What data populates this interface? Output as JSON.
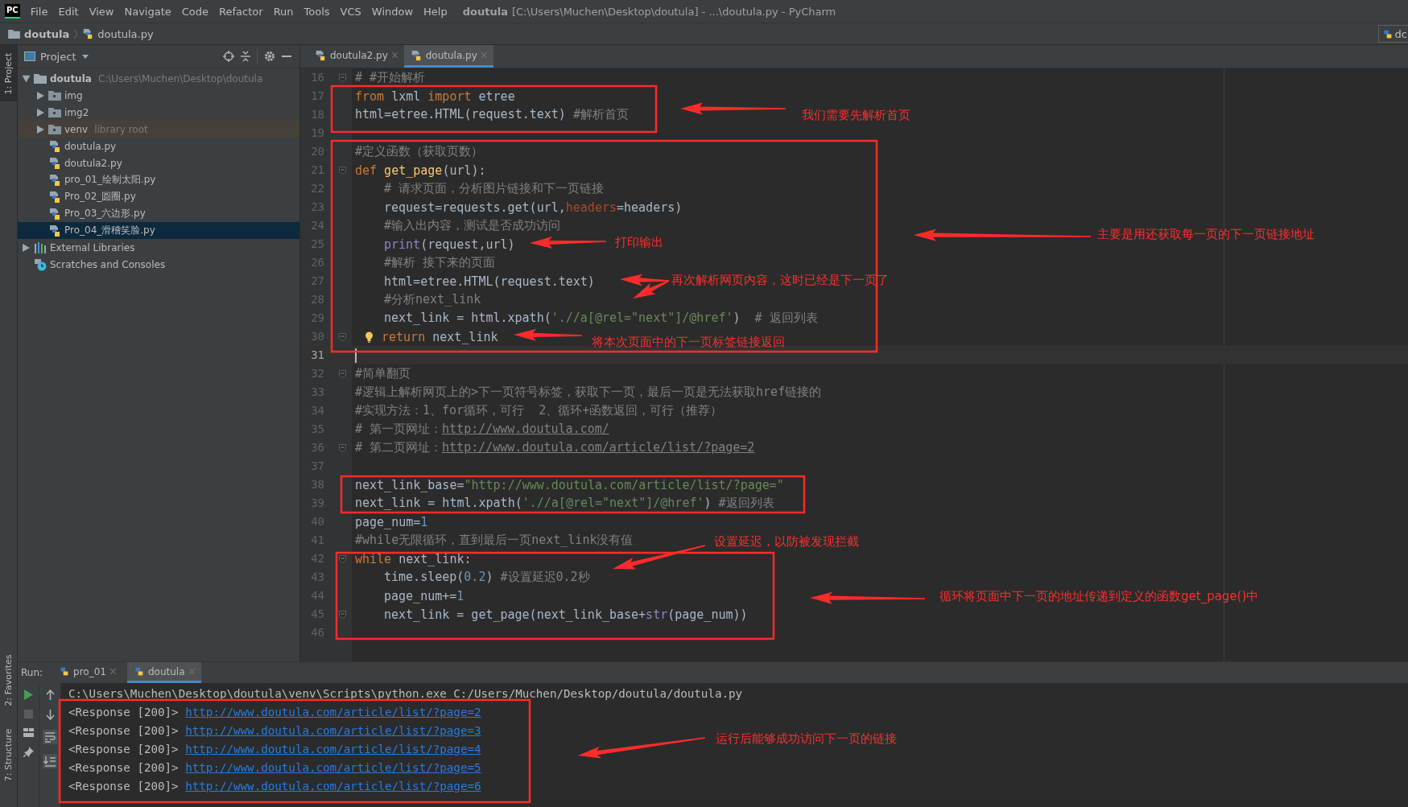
{
  "window": {
    "app_logo": "PC",
    "menu": [
      "File",
      "Edit",
      "View",
      "Navigate",
      "Code",
      "Refactor",
      "Run",
      "Tools",
      "VCS",
      "Window",
      "Help"
    ],
    "title_project": "doutula",
    "title_rest": "[C:\\Users\\Muchen\\Desktop\\doutula] - ...\\doutula.py - PyCharm"
  },
  "breadcrumb": [
    "doutula",
    "doutula.py"
  ],
  "corner_button": "dc",
  "side_tabs": [
    {
      "label": "1: Project",
      "selected": true
    },
    {
      "label": "2: Favorites",
      "selected": false
    },
    {
      "label": "7: Structure",
      "selected": false
    }
  ],
  "project_panel": {
    "title": "Project",
    "tree": [
      {
        "label": "doutula",
        "note": "C:\\Users\\Muchen\\Desktop\\doutula",
        "kind": "root_folder",
        "expanded": true,
        "selected": false,
        "children": [
          {
            "label": "img",
            "kind": "folder",
            "expanded": false,
            "selected": false
          },
          {
            "label": "img2",
            "kind": "folder",
            "expanded": false,
            "selected": false
          },
          {
            "label": "venv",
            "note": "library root",
            "kind": "library_folder",
            "expanded": false,
            "selected": false
          },
          {
            "label": "doutula.py",
            "kind": "python_file",
            "selected": false
          },
          {
            "label": "doutula2.py",
            "kind": "python_file",
            "selected": false
          },
          {
            "label": "pro_01_绘制太阳.py",
            "kind": "python_file",
            "selected": false
          },
          {
            "label": "Pro_02_圆圈.py",
            "kind": "python_file",
            "selected": false
          },
          {
            "label": "Pro_03_六边形.py",
            "kind": "python_file",
            "selected": false
          },
          {
            "label": "Pro_04_滑稽笑脸.py",
            "kind": "python_file",
            "selected": true
          }
        ]
      },
      {
        "label": "External Libraries",
        "kind": "libraries",
        "expanded": false,
        "selected": false
      },
      {
        "label": "Scratches and Consoles",
        "kind": "scratches",
        "selected": false
      }
    ]
  },
  "editor": {
    "tabs": [
      {
        "label": "doutula2.py",
        "selected": false
      },
      {
        "label": "doutula.py",
        "selected": true
      }
    ],
    "lines": [
      {
        "number": "16",
        "indented": false,
        "current": false,
        "fold": true,
        "bulb": false,
        "tokens": [
          {
            "kind": "comment",
            "text": "# #开始解析"
          }
        ]
      },
      {
        "number": "17",
        "indented": false,
        "current": false,
        "fold": false,
        "bulb": false,
        "tokens": [
          {
            "kind": "keyword",
            "text": "from"
          },
          {
            "kind": "plain",
            "text": " lxml "
          },
          {
            "kind": "keyword",
            "text": "import"
          },
          {
            "kind": "plain",
            "text": " etree"
          }
        ]
      },
      {
        "number": "18",
        "indented": false,
        "current": false,
        "fold": false,
        "bulb": false,
        "tokens": [
          {
            "kind": "plain",
            "text": "html=etree.HTML(request.text) "
          },
          {
            "kind": "comment",
            "text": "#解析首页"
          }
        ]
      },
      {
        "number": "19",
        "current": false,
        "fold": false,
        "bulb": false
      },
      {
        "number": "20",
        "indented": false,
        "current": false,
        "fold": false,
        "bulb": false,
        "tokens": [
          {
            "kind": "comment",
            "text": "#定义函数（获取页数）"
          }
        ]
      },
      {
        "number": "21",
        "indented": false,
        "current": false,
        "fold": true,
        "bulb": false,
        "tokens": [
          {
            "kind": "keyword",
            "text": "def"
          },
          {
            "kind": "function",
            "text": " get_page"
          },
          {
            "kind": "plain",
            "text": "(url):"
          }
        ]
      },
      {
        "number": "22",
        "indented": true,
        "current": false,
        "fold": false,
        "bulb": false,
        "tokens": [
          {
            "kind": "comment",
            "text": "# 请求页面，分析图片链接和下一页链接"
          }
        ]
      },
      {
        "number": "23",
        "indented": true,
        "current": false,
        "fold": false,
        "bulb": false,
        "tokens": [
          {
            "kind": "plain",
            "text": "request=requests.get(url,"
          },
          {
            "kind": "param",
            "text": "headers"
          },
          {
            "kind": "plain",
            "text": "=headers)"
          }
        ]
      },
      {
        "number": "24",
        "indented": true,
        "current": false,
        "fold": false,
        "bulb": false,
        "tokens": [
          {
            "kind": "comment",
            "text": "#输入出内容，测试是否成功访问"
          }
        ]
      },
      {
        "number": "25",
        "indented": true,
        "current": false,
        "fold": false,
        "bulb": false,
        "tokens": [
          {
            "kind": "builtin",
            "text": "print"
          },
          {
            "kind": "plain",
            "text": "(request,url)"
          }
        ]
      },
      {
        "number": "26",
        "indented": true,
        "current": false,
        "fold": false,
        "bulb": false,
        "tokens": [
          {
            "kind": "comment",
            "text": "#解析 接下来的页面"
          }
        ]
      },
      {
        "number": "27",
        "indented": true,
        "current": false,
        "fold": false,
        "bulb": false,
        "tokens": [
          {
            "kind": "plain",
            "text": "html=etree.HTML(request.text)"
          }
        ]
      },
      {
        "number": "28",
        "indented": true,
        "current": false,
        "fold": false,
        "bulb": false,
        "tokens": [
          {
            "kind": "comment",
            "text": "#分析next_link"
          }
        ]
      },
      {
        "number": "29",
        "indented": true,
        "current": false,
        "fold": false,
        "bulb": false,
        "tokens": [
          {
            "kind": "plain",
            "text": "next_link = html.xpath("
          },
          {
            "kind": "string",
            "text": "'.//a[@rel=\"next\"]/@href'"
          },
          {
            "kind": "plain",
            "text": ")  "
          },
          {
            "kind": "comment",
            "text": "# 返回列表"
          }
        ]
      },
      {
        "number": "30",
        "indented": true,
        "current": false,
        "fold": true,
        "bulb": true,
        "tokens": [
          {
            "kind": "keyword",
            "text": "return"
          },
          {
            "kind": "plain",
            "text": " next_link"
          }
        ]
      },
      {
        "number": "31",
        "current": true,
        "fold": false,
        "bulb": false
      },
      {
        "number": "32",
        "indented": false,
        "current": false,
        "fold": true,
        "bulb": false,
        "tokens": [
          {
            "kind": "comment",
            "text": "#简单翻页"
          }
        ]
      },
      {
        "number": "33",
        "indented": false,
        "current": false,
        "fold": false,
        "bulb": false,
        "tokens": [
          {
            "kind": "comment",
            "text": "#逻辑上解析网页上的>下一页符号标签，获取下一页，最后一页是无法获取href链接的"
          }
        ]
      },
      {
        "number": "34",
        "indented": false,
        "current": false,
        "fold": false,
        "bulb": false,
        "tokens": [
          {
            "kind": "comment",
            "text": "#实现方法：1、for循环，可行  2、循环+函数返回，可行（推荐）"
          }
        ]
      },
      {
        "number": "35",
        "indented": false,
        "current": false,
        "fold": false,
        "bulb": false,
        "tokens": [
          {
            "kind": "comment",
            "text": "# 第一页网址："
          },
          {
            "kind": "link",
            "text": "http://www.doutula.com/"
          }
        ]
      },
      {
        "number": "36",
        "indented": false,
        "current": false,
        "fold": true,
        "bulb": false,
        "tokens": [
          {
            "kind": "comment",
            "text": "# 第二页网址："
          },
          {
            "kind": "link",
            "text": "http://www.doutula.com/article/list/?page=2"
          }
        ]
      },
      {
        "number": "37",
        "current": false,
        "fold": false,
        "bulb": false
      },
      {
        "number": "38",
        "indented": false,
        "current": false,
        "fold": false,
        "bulb": false,
        "tokens": [
          {
            "kind": "plain",
            "text": "next_link_base="
          },
          {
            "kind": "string",
            "text": "\"http://www.doutula.com/article/list/?page=\""
          }
        ]
      },
      {
        "number": "39",
        "indented": false,
        "current": false,
        "fold": false,
        "bulb": false,
        "tokens": [
          {
            "kind": "plain",
            "text": "next_link = html.xpath("
          },
          {
            "kind": "string",
            "text": "'.//a[@rel=\"next\"]/@href'"
          },
          {
            "kind": "plain",
            "text": ") "
          },
          {
            "kind": "comment",
            "text": "#返回列表"
          }
        ]
      },
      {
        "number": "40",
        "indented": false,
        "current": false,
        "fold": false,
        "bulb": false,
        "tokens": [
          {
            "kind": "plain",
            "text": "page_num="
          },
          {
            "kind": "number",
            "text": "1"
          }
        ]
      },
      {
        "number": "41",
        "indented": false,
        "current": false,
        "fold": false,
        "bulb": false,
        "tokens": [
          {
            "kind": "comment",
            "text": "#while无限循环，直到最后一页next_link没有值"
          }
        ]
      },
      {
        "number": "42",
        "indented": false,
        "current": false,
        "fold": true,
        "bulb": false,
        "tokens": [
          {
            "kind": "keyword",
            "text": "while"
          },
          {
            "kind": "plain",
            "text": " next_link:"
          }
        ]
      },
      {
        "number": "43",
        "indented": true,
        "current": false,
        "fold": false,
        "bulb": false,
        "tokens": [
          {
            "kind": "plain",
            "text": "time.sleep("
          },
          {
            "kind": "number",
            "text": "0.2"
          },
          {
            "kind": "plain",
            "text": ") "
          },
          {
            "kind": "comment",
            "text": "#设置延迟0.2秒"
          }
        ]
      },
      {
        "number": "44",
        "indented": true,
        "current": false,
        "fold": false,
        "bulb": false,
        "tokens": [
          {
            "kind": "plain",
            "text": "page_num+="
          },
          {
            "kind": "number",
            "text": "1"
          }
        ]
      },
      {
        "number": "45",
        "indented": true,
        "current": false,
        "fold": true,
        "bulb": false,
        "tokens": [
          {
            "kind": "plain",
            "text": "next_link = get_page(next_link_base+"
          },
          {
            "kind": "builtin",
            "text": "str"
          },
          {
            "kind": "plain",
            "text": "(page_num))"
          }
        ]
      },
      {
        "number": "46",
        "current": false,
        "fold": false,
        "bulb": false
      }
    ]
  },
  "run_panel": {
    "label": "Run:",
    "tabs": [
      {
        "label": "pro_01",
        "selected": false
      },
      {
        "label": "doutula",
        "selected": true
      }
    ],
    "console": [
      {
        "text": "C:\\Users\\Muchen\\Desktop\\doutula\\venv\\Scripts\\python.exe C:/Users/Muchen/Desktop/doutula/doutula.py"
      },
      {
        "text": "<Response [200]> ",
        "link": "http://www.doutula.com/article/list/?page=2"
      },
      {
        "text": "<Response [200]> ",
        "link": "http://www.doutula.com/article/list/?page=3"
      },
      {
        "text": "<Response [200]> ",
        "link": "http://www.doutula.com/article/list/?page=4"
      },
      {
        "text": "<Response [200]> ",
        "link": "http://www.doutula.com/article/list/?page=5"
      },
      {
        "text": "<Response [200]> ",
        "link": "http://www.doutula.com/article/list/?page=6"
      }
    ]
  },
  "annotations": [
    {
      "text": "我们需要先解析首页"
    },
    {
      "text": "主要是用还获取每一页的下一页链接地址"
    },
    {
      "text": "打印输出"
    },
    {
      "text": "再次解析网页内容，这时已经是下一页了"
    },
    {
      "text": "将本次页面中的下一页标签链接返回"
    },
    {
      "text": "设置延迟，以防被发现拦截"
    },
    {
      "text": "循环将页面中下一页的地址传递到定义的函数get_page()中"
    },
    {
      "text": "运行后能够成功访问下一页的链接"
    }
  ]
}
